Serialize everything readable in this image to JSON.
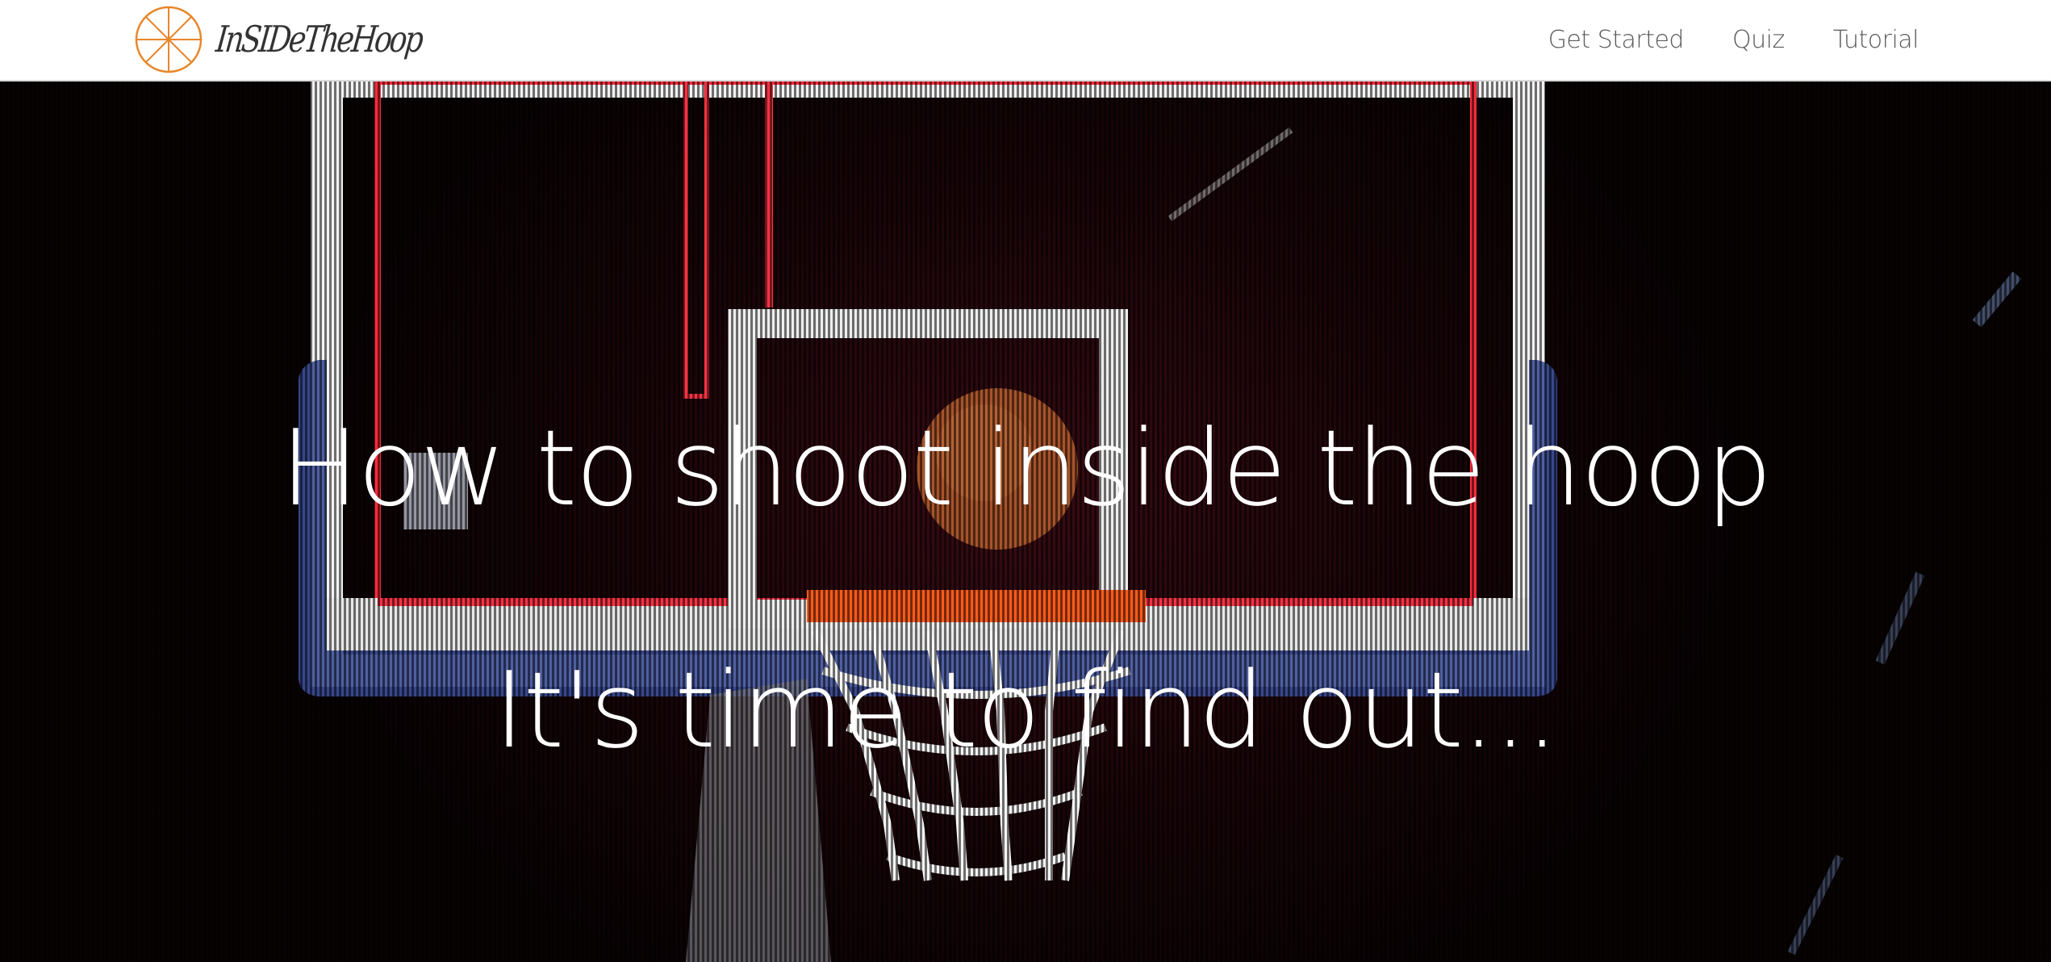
{
  "navbar": {
    "brand_name": "InSIDeTheHoop",
    "links": [
      {
        "label": "Get Started"
      },
      {
        "label": "Quiz"
      },
      {
        "label": "Tutorial"
      }
    ],
    "logo_icon": "basketball-icon",
    "logo_color": "#e8862a"
  },
  "hero": {
    "title": "How to shoot inside the hoop",
    "subtitle": "It's time to find out...",
    "background_image": "basketball-hoop-dunk-photo",
    "text_color": "#ffffff"
  }
}
